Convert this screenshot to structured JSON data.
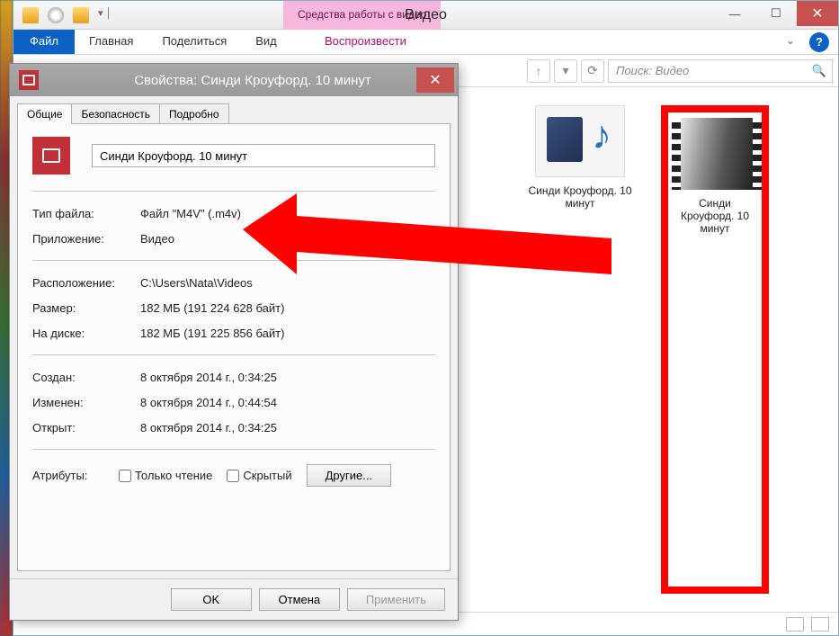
{
  "window": {
    "context_tab": "Средства работы с видео",
    "title": "Видео"
  },
  "ribbon": {
    "file": "Файл",
    "tabs": [
      "Главная",
      "Поделиться",
      "Вид"
    ],
    "play_tab": "Воспроизвести"
  },
  "search": {
    "placeholder": "Поиск: Видео"
  },
  "files": {
    "item1": "Синди Кроуфорд. 10 минут",
    "item2": "Синди Кроуфорд. 10 минут"
  },
  "props": {
    "title": "Свойства: Синди Кроуфорд. 10 минут",
    "tabs": {
      "general": "Общие",
      "security": "Безопасность",
      "details": "Подробно"
    },
    "filename": "Синди Кроуфорд. 10 минут",
    "rows": {
      "type_lbl": "Тип файла:",
      "type_val": "Файл \"M4V\" (.m4v)",
      "app_lbl": "Приложение:",
      "app_val": "Видео",
      "loc_lbl": "Расположение:",
      "loc_val": "C:\\Users\\Nata\\Videos",
      "size_lbl": "Размер:",
      "size_val": "182 МБ (191 224 628 байт)",
      "disk_lbl": "На диске:",
      "disk_val": "182 МБ (191 225 856 байт)",
      "created_lbl": "Создан:",
      "created_val": "8 октября 2014 г., 0:34:25",
      "modified_lbl": "Изменен:",
      "modified_val": "8 октября 2014 г., 0:44:54",
      "accessed_lbl": "Открыт:",
      "accessed_val": "8 октября 2014 г., 0:34:25",
      "attr_lbl": "Атрибуты:"
    },
    "readonly": "Только чтение",
    "hidden": "Скрытый",
    "other_btn": "Другие...",
    "ok": "OK",
    "cancel": "Отмена",
    "apply": "Применить"
  }
}
